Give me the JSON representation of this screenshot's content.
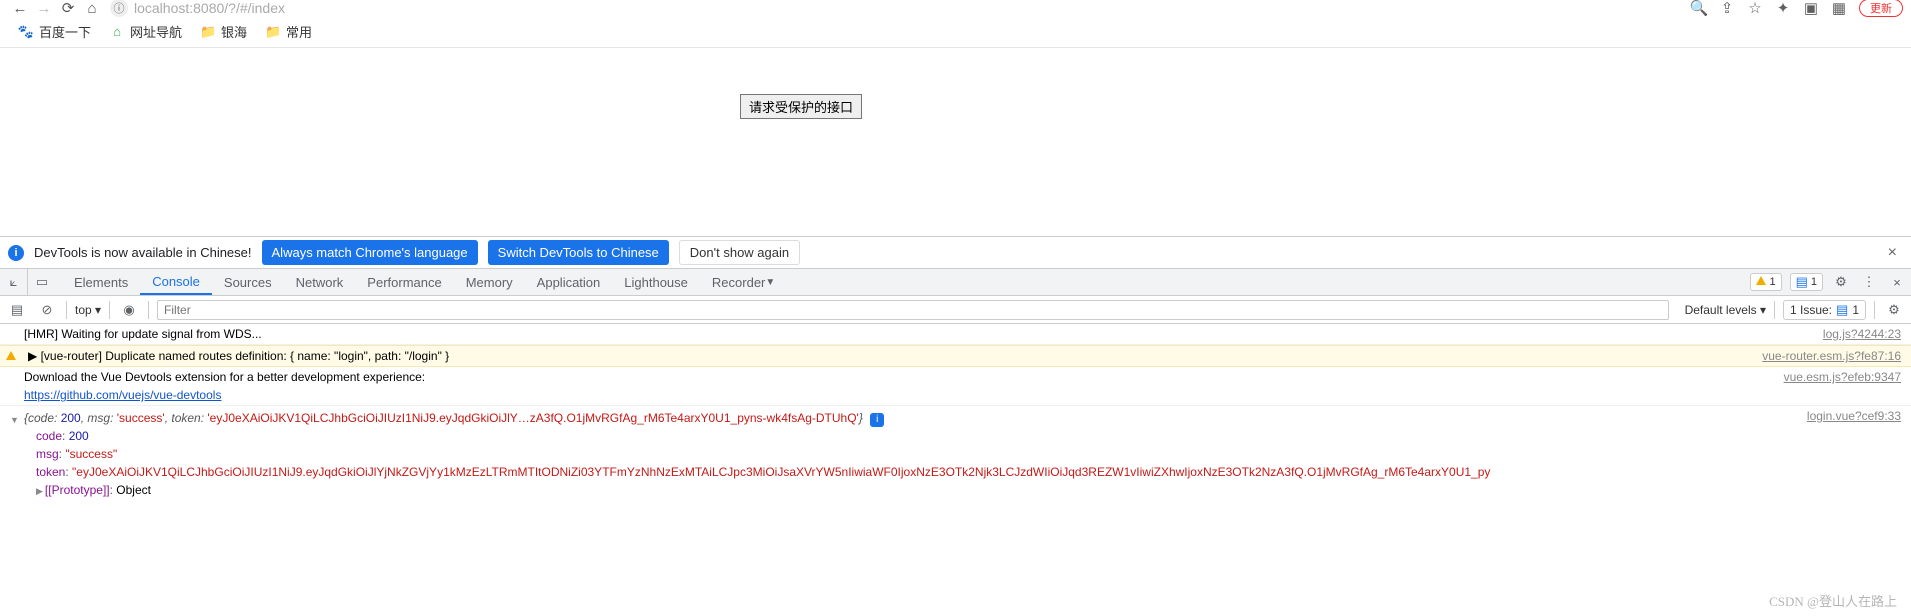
{
  "browser": {
    "url": "localhost:8080/?/#/index",
    "update_label": "更新",
    "bookmarks": [
      {
        "icon": "baidu",
        "label": "百度一下"
      },
      {
        "icon": "nav2345",
        "label": "网址导航"
      },
      {
        "icon": "folder",
        "label": "银海"
      },
      {
        "icon": "folder",
        "label": "常用"
      }
    ]
  },
  "page": {
    "button_label": "请求受保护的接口"
  },
  "infobar": {
    "text": "DevTools is now available in Chinese!",
    "btn_always": "Always match Chrome's language",
    "btn_switch": "Switch DevTools to Chinese",
    "btn_dont": "Don't show again"
  },
  "devtools": {
    "tabs": [
      "Elements",
      "Console",
      "Sources",
      "Network",
      "Performance",
      "Memory",
      "Application",
      "Lighthouse",
      "Recorder"
    ],
    "active_tab": "Console",
    "warn_count": "1",
    "msg_count": "1",
    "console_bar": {
      "context": "top",
      "filter_ph": "Filter",
      "levels": "Default levels",
      "issue_label": "1 Issue:",
      "issue_count": "1"
    }
  },
  "log": {
    "hmr": "[HMR] Waiting for update signal from WDS...",
    "hmr_src": "log.js?4244:23",
    "warn_prefix": "▶ [vue-router] Duplicate named routes definition: { name: \"login\", path: \"/login\" }",
    "warn_src": "vue-router.esm.js?fe87:16",
    "vdt_text": "Download the Vue Devtools extension for a better development experience:",
    "vdt_link": "https://github.com/vuejs/vue-devtools",
    "vdt_src": "vue.esm.js?efeb:9347",
    "obj_src": "login.vue?cef9:33",
    "obj_inline_pre": "{code: ",
    "obj_inline_code": "200",
    "obj_inline_mid1": ", msg: ",
    "obj_inline_msg": "'success'",
    "obj_inline_mid2": ", token: ",
    "obj_inline_token": "'eyJ0eXAiOiJKV1QiLCJhbGciOiJIUzI1NiJ9.eyJqdGkiOiJlY…zA3fQ.O1jMvRGfAg_rM6Te4arxY0U1_pyns-wk4fsAg-DTUhQ'",
    "obj_inline_end": "}",
    "expanded": {
      "code_k": "code",
      "code_v": "200",
      "msg_k": "msg",
      "msg_v": "\"success\"",
      "token_k": "token",
      "token_v": "\"eyJ0eXAiOiJKV1QiLCJhbGciOiJIUzI1NiJ9.eyJqdGkiOiJlYjNkZGVjYy1kMzEzLTRmMTItODNiZi03YTFmYzNhNzExMTAiLCJpc3MiOiJsaXVrYW5nIiwiaWF0IjoxNzE3OTk2Njk3LCJzdWIiOiJqd3REZW1vIiwiZXhwIjoxNzE3OTk2NzA3fQ.O1jMvRGfAg_rM6Te4arxY0U1_py",
      "proto_k": "[[Prototype]]",
      "proto_v": "Object"
    }
  },
  "watermark": "CSDN @登山人在路上"
}
